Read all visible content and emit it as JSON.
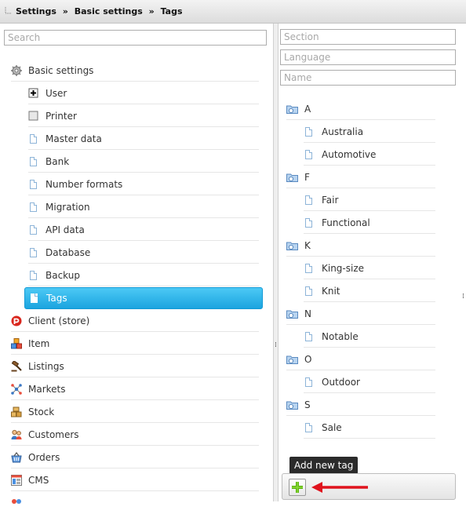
{
  "breadcrumb": {
    "items": [
      "Settings",
      "»",
      "Basic settings",
      "»",
      "Tags"
    ]
  },
  "search": {
    "placeholder": "Search"
  },
  "nav": {
    "basic_settings": "Basic settings",
    "sub_items": [
      "User",
      "Printer",
      "Master data",
      "Bank",
      "Number formats",
      "Migration",
      "API data",
      "Database",
      "Backup",
      "Tags"
    ],
    "selected": "Tags",
    "top_items": [
      "Client (store)",
      "Item",
      "Listings",
      "Markets",
      "Stock",
      "Customers",
      "Orders",
      "CMS"
    ]
  },
  "filters": {
    "section_placeholder": "Section",
    "language_placeholder": "Language",
    "name_placeholder": "Name"
  },
  "tags": {
    "groups": [
      {
        "letter": "A",
        "items": [
          "Australia",
          "Automotive"
        ]
      },
      {
        "letter": "F",
        "items": [
          "Fair",
          "Functional"
        ]
      },
      {
        "letter": "K",
        "items": [
          "King-size",
          "Knit"
        ]
      },
      {
        "letter": "N",
        "items": [
          "Notable"
        ]
      },
      {
        "letter": "O",
        "items": [
          "Outdoor"
        ]
      },
      {
        "letter": "S",
        "items": [
          "Sale"
        ]
      }
    ]
  },
  "toolbar": {
    "add_tooltip": "Add new tag"
  },
  "colors": {
    "selection": "#1ba4df",
    "arrow": "#e0141e",
    "add_icon": "#5bb40f"
  }
}
